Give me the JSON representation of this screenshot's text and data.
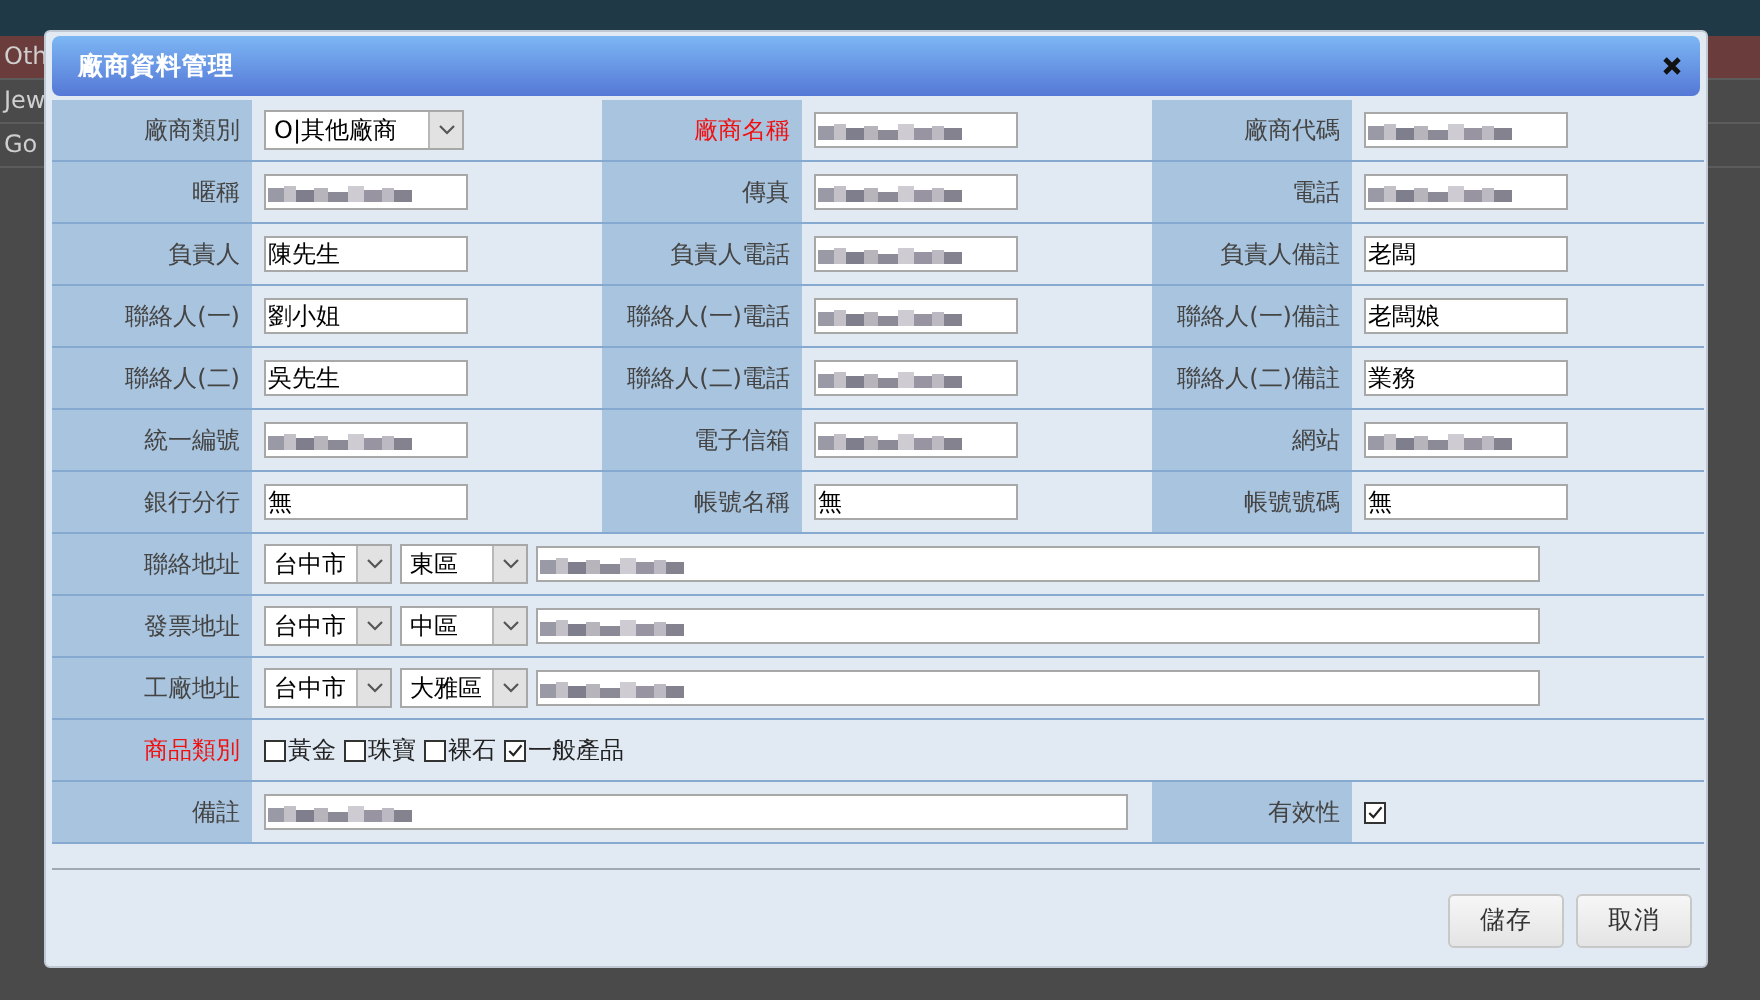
{
  "backdrop": {
    "rows": [
      {
        "cell": "Oth",
        "selected": true
      },
      {
        "cell": "Jew",
        "selected": false
      },
      {
        "cell": "Go",
        "selected": false
      }
    ]
  },
  "dialog": {
    "title": "廠商資料管理"
  },
  "fields": [
    {
      "label": "廠商類別",
      "required": false,
      "kind": "select",
      "value": "O|其他廠商"
    },
    {
      "label": "廠商名稱",
      "required": true,
      "kind": "text",
      "redacted": true
    },
    {
      "label": "廠商代碼",
      "required": false,
      "kind": "text",
      "redacted": true
    },
    {
      "label": "暱稱",
      "required": false,
      "kind": "text",
      "redacted": true
    },
    {
      "label": "傳真",
      "required": false,
      "kind": "text",
      "redacted": true
    },
    {
      "label": "電話",
      "required": false,
      "kind": "text",
      "redacted": true
    },
    {
      "label": "負責人",
      "required": false,
      "kind": "text",
      "value": "陳先生"
    },
    {
      "label": "負責人電話",
      "required": false,
      "kind": "text",
      "redacted": true
    },
    {
      "label": "負責人備註",
      "required": false,
      "kind": "text",
      "value": "老闆"
    },
    {
      "label": "聯絡人(一)",
      "required": false,
      "kind": "text",
      "value": "劉小姐"
    },
    {
      "label": "聯絡人(一)電話",
      "required": false,
      "kind": "text",
      "redacted": true
    },
    {
      "label": "聯絡人(一)備註",
      "required": false,
      "kind": "text",
      "value": "老闆娘"
    },
    {
      "label": "聯絡人(二)",
      "required": false,
      "kind": "text",
      "value": "吳先生"
    },
    {
      "label": "聯絡人(二)電話",
      "required": false,
      "kind": "text",
      "redacted": true
    },
    {
      "label": "聯絡人(二)備註",
      "required": false,
      "kind": "text",
      "value": "業務"
    },
    {
      "label": "統一編號",
      "required": false,
      "kind": "text",
      "redacted": true
    },
    {
      "label": "電子信箱",
      "required": false,
      "kind": "text",
      "redacted": true
    },
    {
      "label": "網站",
      "required": false,
      "kind": "text",
      "redacted": true
    },
    {
      "label": "銀行分行",
      "required": false,
      "kind": "text",
      "value": "無"
    },
    {
      "label": "帳號名稱",
      "required": false,
      "kind": "text",
      "value": "無"
    },
    {
      "label": "帳號號碼",
      "required": false,
      "kind": "text",
      "value": "無"
    }
  ],
  "addresses": [
    {
      "label": "聯絡地址",
      "city": "台中市",
      "district": "東區",
      "redacted": true
    },
    {
      "label": "發票地址",
      "city": "台中市",
      "district": "中區",
      "redacted": true
    },
    {
      "label": "工廠地址",
      "city": "台中市",
      "district": "大雅區",
      "redacted": true
    }
  ],
  "categories": {
    "label": "商品類別",
    "required": true,
    "options": [
      {
        "label": "黃金",
        "checked": false
      },
      {
        "label": "珠寶",
        "checked": false
      },
      {
        "label": "裸石",
        "checked": false
      },
      {
        "label": "一般產品",
        "checked": true
      }
    ]
  },
  "remarks": {
    "label": "備註",
    "redacted": true
  },
  "validity": {
    "label": "有效性",
    "checked": true
  },
  "buttons": [
    "儲存",
    "取消"
  ]
}
